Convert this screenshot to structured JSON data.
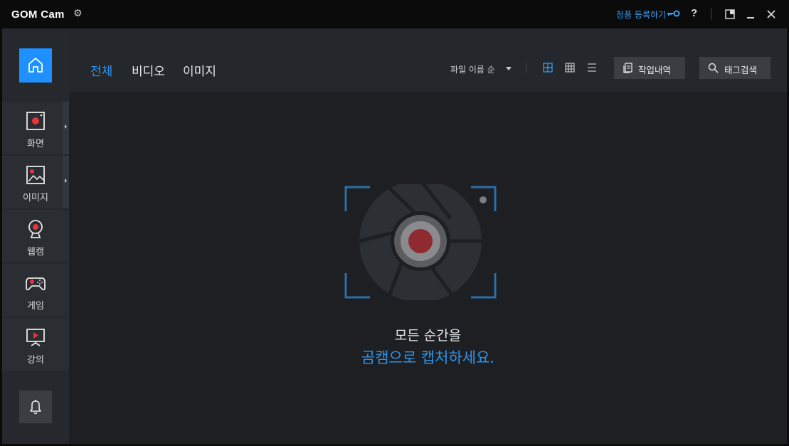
{
  "titlebar": {
    "brand": "GOM Cam",
    "register_label": "정품 등록하기",
    "help_label": "?"
  },
  "sidebar": {
    "items": [
      {
        "label": "화면",
        "icon": "screen-record-icon"
      },
      {
        "label": "이미지",
        "icon": "image-icon"
      },
      {
        "label": "웹캠",
        "icon": "webcam-icon"
      },
      {
        "label": "게임",
        "icon": "gamepad-icon"
      },
      {
        "label": "강의",
        "icon": "lecture-icon"
      }
    ]
  },
  "header": {
    "tabs": [
      {
        "label": "전체",
        "active": true
      },
      {
        "label": "비디오",
        "active": false
      },
      {
        "label": "이미지",
        "active": false
      }
    ],
    "sort_label": "파일 이름 순",
    "work_history_label": "작업내역",
    "tag_search_label": "태그검색"
  },
  "main": {
    "empty_line1": "모든 순간을",
    "empty_line2": "곰캠으로 캡처하세요."
  },
  "colors": {
    "accent": "#2f93ea",
    "home_active": "#1e90ff",
    "record_red": "#8e2a30"
  }
}
